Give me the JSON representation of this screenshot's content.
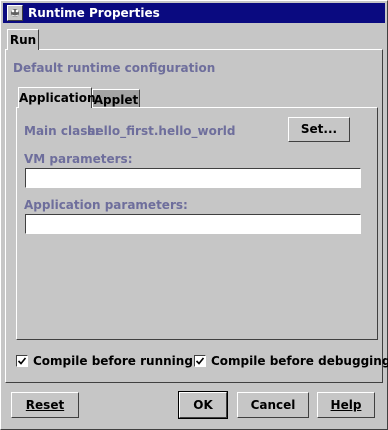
{
  "window": {
    "title": "Runtime Properties"
  },
  "outer_tabs": [
    {
      "label": "Run",
      "active": true
    }
  ],
  "run": {
    "heading": "Default runtime configuration",
    "inner_tabs": [
      {
        "label": "Application",
        "active": true
      },
      {
        "label": "Applet",
        "active": false
      }
    ],
    "main_class_label": "Main class:",
    "main_class_value": "hello_first.hello_world",
    "set_button": "Set...",
    "vm_params_label": "VM parameters:",
    "vm_params_value": "",
    "app_params_label": "Application parameters:",
    "app_params_value": ""
  },
  "options": {
    "compile_before_running": {
      "label": "Compile before running",
      "checked": true
    },
    "compile_before_debugging": {
      "label": "Compile before debugging",
      "checked": true
    }
  },
  "buttons": {
    "reset": "Reset",
    "ok": "OK",
    "cancel": "Cancel",
    "help": "Help"
  },
  "icons": {
    "app": "app-icon",
    "check": "check-icon",
    "close": "close-icon"
  },
  "colors": {
    "titlebar": "#0a0a80",
    "dialog": "#c6c6c6",
    "label_text": "#6e6e9c"
  }
}
